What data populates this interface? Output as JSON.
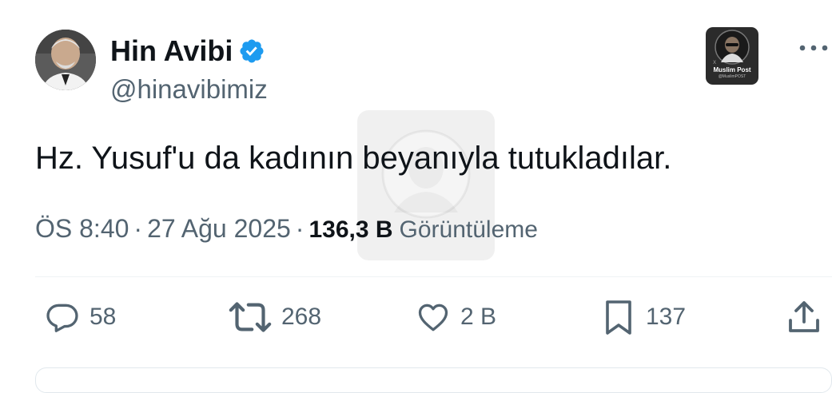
{
  "author": {
    "display_name": "Hin Avibi",
    "handle": "@hinavibimiz",
    "verified": true,
    "verified_color": "#1d9bf0"
  },
  "watermark_logo": {
    "title": "Muslim Post",
    "subtitle": "@MuslimPOST"
  },
  "tweet": {
    "text": "Hz. Yusuf'u da kadının beyanıyla tutukladılar.",
    "time": "ÖS 8:40",
    "date": "27 Ağu 2025",
    "separator": "·",
    "views_count": "136,3 B",
    "views_label": "Görüntüleme"
  },
  "actions": {
    "replies": "58",
    "reposts": "268",
    "likes": "2 B",
    "bookmarks": "137"
  },
  "icons": [
    "verified-badge-icon",
    "more-icon",
    "reply-icon",
    "repost-icon",
    "like-icon",
    "bookmark-icon",
    "share-icon"
  ],
  "colors": {
    "text_primary": "#0f1419",
    "text_secondary": "#536471",
    "accent": "#1d9bf0"
  }
}
